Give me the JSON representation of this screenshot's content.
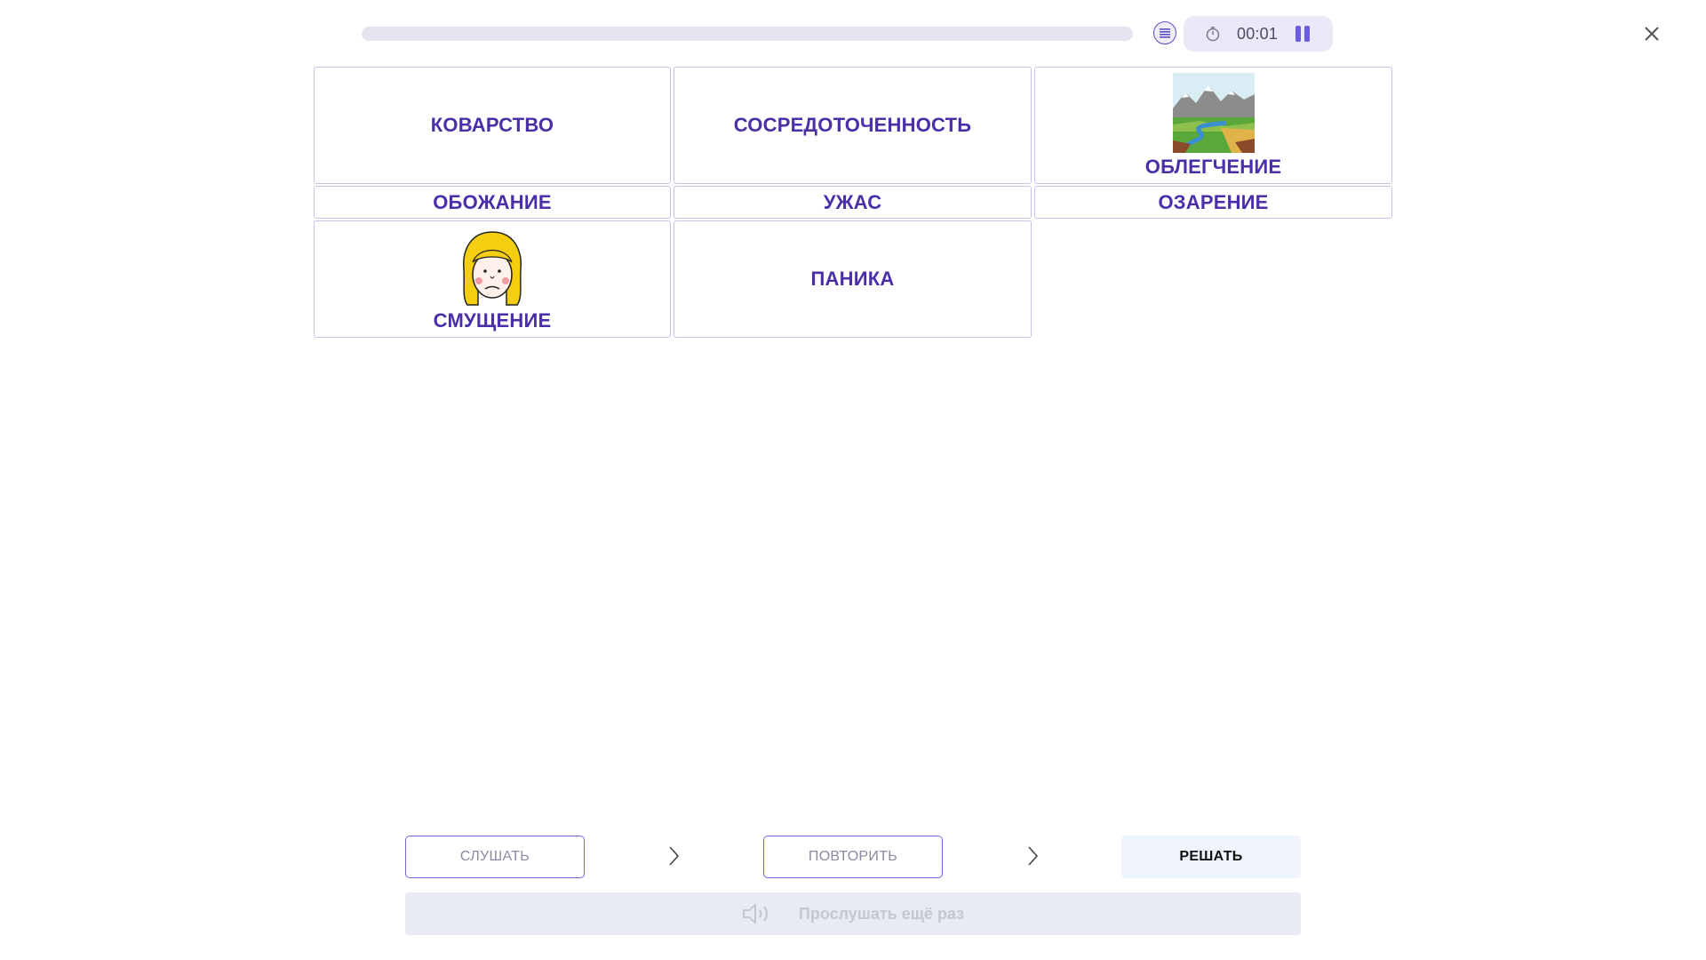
{
  "header": {
    "progress": 0,
    "timer": "00:01"
  },
  "grid": [
    {
      "label": "КОВАРСТВО",
      "image": null
    },
    {
      "label": "СОСРЕДОТОЧЕННОСТЬ",
      "image": null
    },
    {
      "label": "ОБЛЕГЧЕНИЕ",
      "image": "landscape-picture"
    },
    {
      "label": "ОБОЖАНИЕ",
      "image": null
    },
    {
      "label": "УЖАС",
      "image": null
    },
    {
      "label": "ОЗАРЕНИЕ",
      "image": null
    },
    {
      "label": "СМУЩЕНИЕ",
      "image": "face-picture"
    },
    {
      "label": "ПАНИКА",
      "image": null
    }
  ],
  "steps": {
    "listen": "СЛУШАТЬ",
    "repeat": "ПОВТОРИТЬ",
    "solve": "РЕШАТЬ",
    "active": "solve"
  },
  "replay": {
    "label": "Прослушать ещё раз",
    "icon": "speaker-icon"
  },
  "colors": {
    "accent": "#4a2fa8",
    "cell_border": "#c9c2ec",
    "button_border": "#7c63d8",
    "active_step_bg": "#eef3fc",
    "replay_bg": "#e8ebf1"
  }
}
